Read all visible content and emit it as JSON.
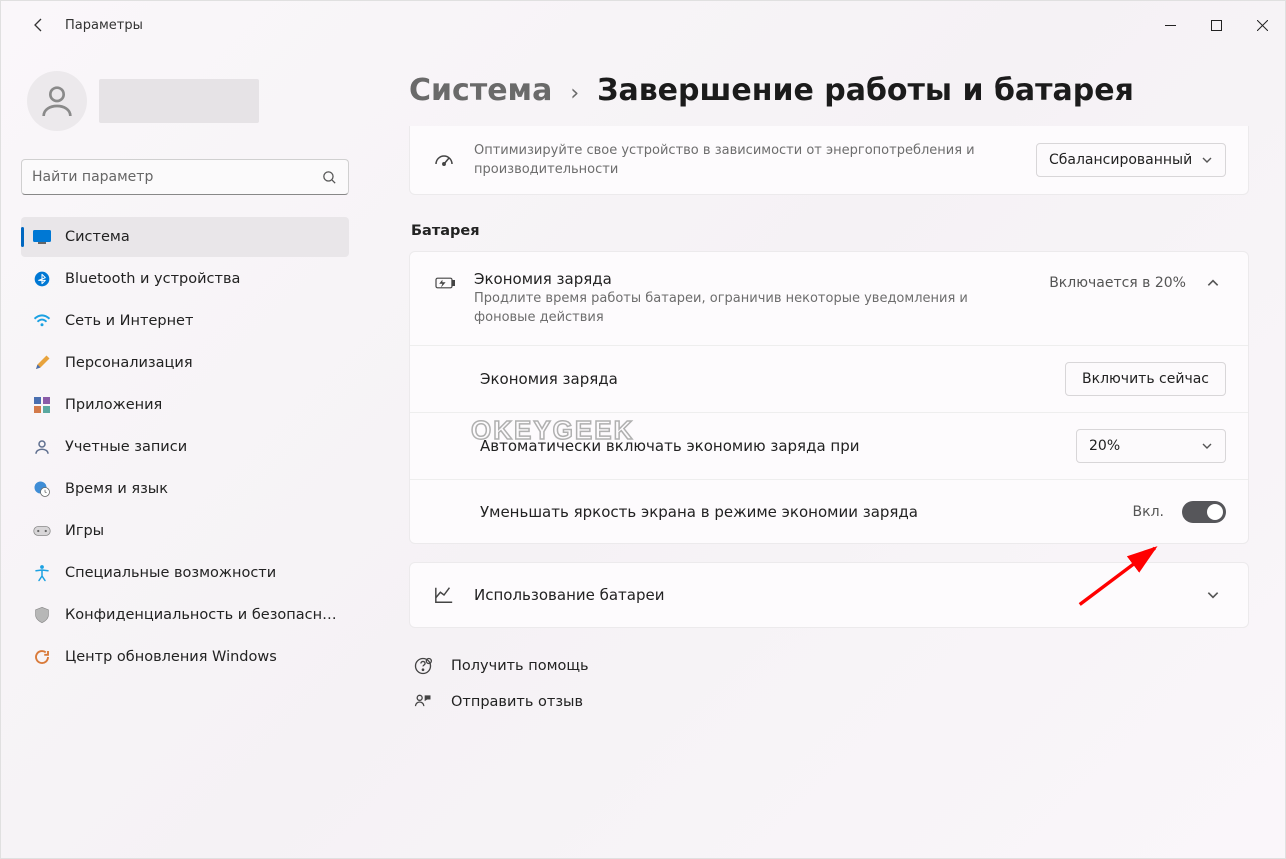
{
  "titlebar": {
    "title": "Параметры"
  },
  "search": {
    "placeholder": "Найти параметр"
  },
  "nav": {
    "items": [
      {
        "label": "Система"
      },
      {
        "label": "Bluetooth и устройства"
      },
      {
        "label": "Сеть и Интернет"
      },
      {
        "label": "Персонализация"
      },
      {
        "label": "Приложения"
      },
      {
        "label": "Учетные записи"
      },
      {
        "label": "Время и язык"
      },
      {
        "label": "Игры"
      },
      {
        "label": "Специальные возможности"
      },
      {
        "label": "Конфиденциальность и безопасность"
      },
      {
        "label": "Центр обновления Windows"
      }
    ]
  },
  "breadcrumb": {
    "root": "Система",
    "leaf": "Завершение работы и батарея"
  },
  "power_mode": {
    "desc": "Оптимизируйте свое устройство в зависимости от энергопотребления и производительности",
    "value": "Сбалансированный"
  },
  "battery_section": {
    "label": "Батарея"
  },
  "saver": {
    "title": "Экономия заряда",
    "desc": "Продлите время работы батареи, ограничив некоторые уведомления и фоновые действия",
    "status": "Включается в 20%",
    "enable_now_title": "Экономия заряда",
    "enable_now_btn": "Включить сейчас",
    "auto_title": "Автоматически включать экономию заряда при",
    "auto_value": "20%",
    "dim_title": "Уменьшать яркость экрана в режиме экономии заряда",
    "dim_state": "Вкл."
  },
  "usage": {
    "title": "Использование батареи"
  },
  "footer": {
    "help": "Получить помощь",
    "feedback": "Отправить отзыв"
  },
  "watermark": "OKEYGEEK"
}
